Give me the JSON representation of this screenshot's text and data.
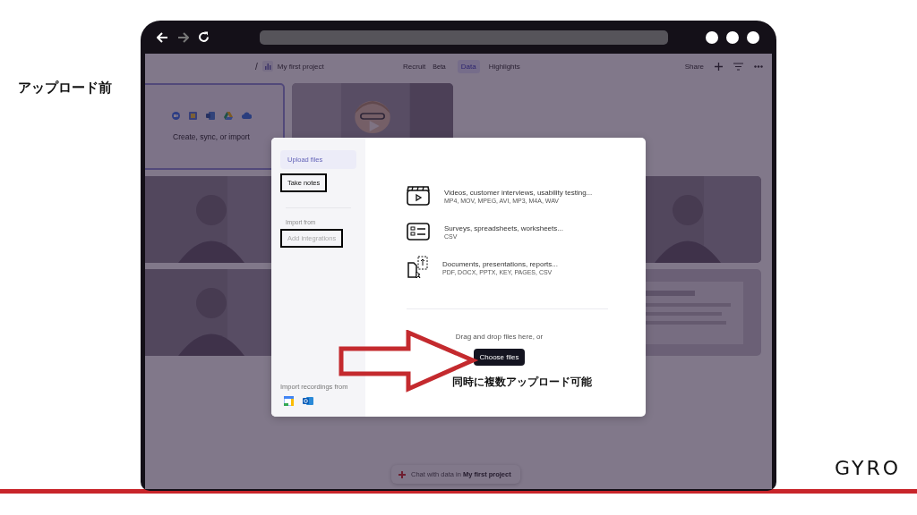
{
  "slide": {
    "caption": "アップロード前",
    "logo": "GYRO"
  },
  "app_header": {
    "separator": "/",
    "project": "My first project",
    "tabs": [
      {
        "label": "Recruit",
        "badge": "Beta",
        "selected": false
      },
      {
        "label": "Data",
        "selected": true
      },
      {
        "label": "Highlights",
        "selected": false
      }
    ],
    "share": "Share"
  },
  "tiles": [
    {
      "kind": "import",
      "label": "Create, sync, or import"
    },
    {
      "kind": "video"
    },
    {
      "kind": "blank"
    },
    {
      "kind": "blank"
    },
    {
      "kind": "person"
    },
    {
      "kind": "blank"
    },
    {
      "kind": "blank"
    },
    {
      "kind": "person"
    },
    {
      "kind": "person"
    },
    {
      "kind": "blank"
    },
    {
      "kind": "blank"
    },
    {
      "kind": "document"
    }
  ],
  "modal": {
    "nav": [
      {
        "label": "Upload files",
        "selected": true,
        "boxed": false
      },
      {
        "label": "Take notes",
        "selected": false,
        "boxed": true
      }
    ],
    "import_heading": "Import from",
    "integrations": [
      {
        "label": "Add integrations",
        "disabled": true,
        "boxed": true
      }
    ],
    "recordings_heading": "Import recordings from",
    "file_types": [
      {
        "kind": "video",
        "title": "Videos, customer interviews, usability testing...",
        "formats": "MP4, MOV, MPEG, AVI, MP3, M4A, WAV"
      },
      {
        "kind": "survey",
        "title": "Surveys, spreadsheets, worksheets...",
        "formats": "CSV"
      },
      {
        "kind": "document",
        "title": "Documents, presentations, reports...",
        "formats": "PDF, DOCX, PPTX, KEY, PAGES, CSV"
      }
    ],
    "drop_prompt": "Drag and drop files here, or",
    "choose_button": "Choose files",
    "annotation": "同時に複数アップロード可能"
  },
  "chat": {
    "text": "Chat with data in **My first project**"
  }
}
